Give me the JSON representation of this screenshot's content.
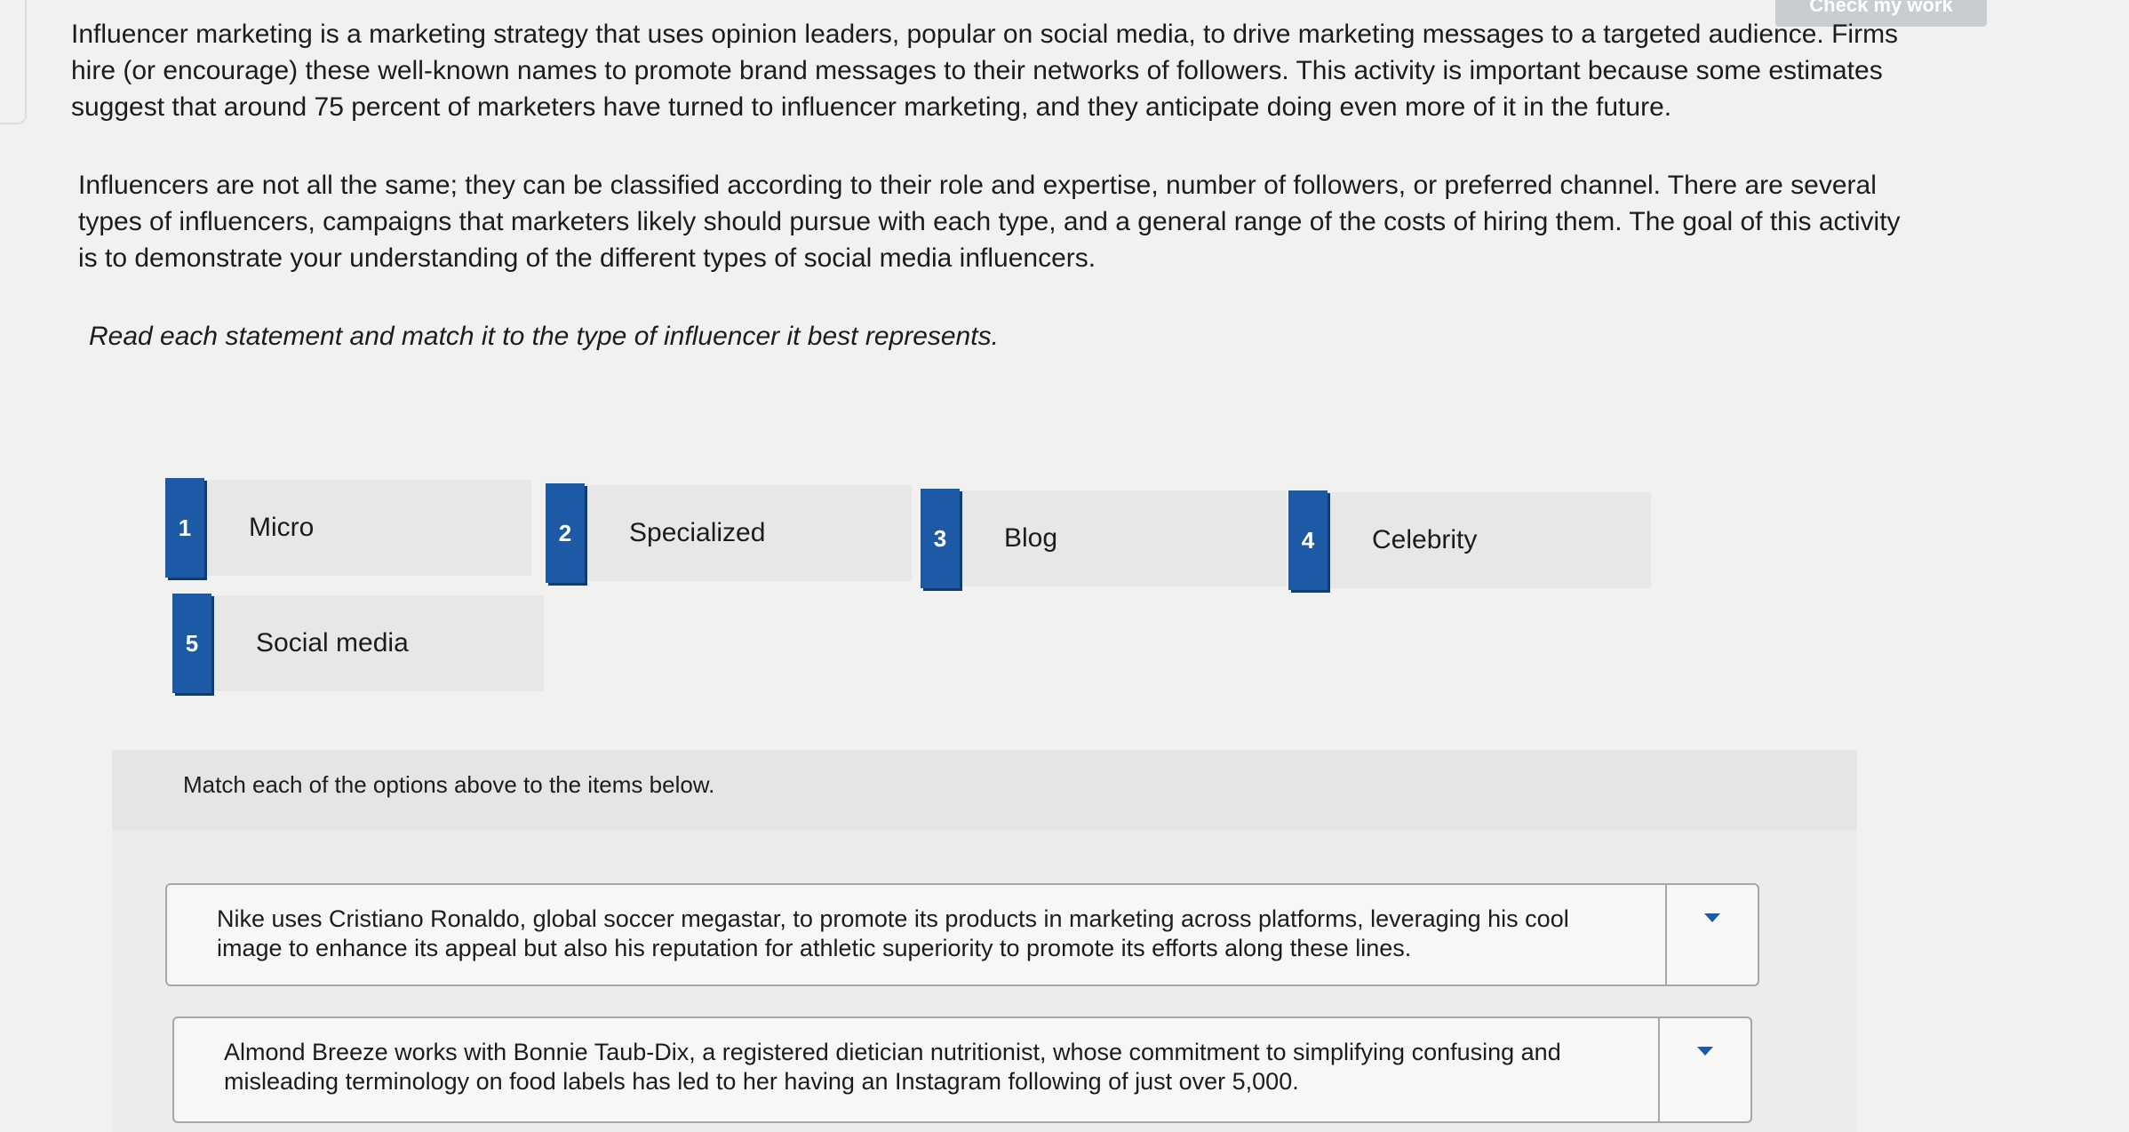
{
  "header": {
    "check_work_label": "Check my work"
  },
  "intro": {
    "paragraph1": "Influencer marketing is a marketing strategy that uses opinion leaders, popular on social media, to drive marketing messages to a targeted audience. Firms hire (or encourage) these well-known names to promote brand messages to their networks of followers. This activity is important because some estimates suggest that around 75 percent of marketers have turned to influencer marketing, and they anticipate doing even more of it in the future.",
    "paragraph2": "Influencers are not all the same; they can be classified according to their role and expertise, number of followers, or preferred channel. There are several types of influencers, campaigns that marketers likely should pursue with each type, and a general range of the costs of hiring them. The goal of this activity is to demonstrate your understanding of the different types of social media influencers.",
    "instruction": "Read each statement and match it to the type of influencer it best represents."
  },
  "options": [
    {
      "number": "1",
      "label": "Micro"
    },
    {
      "number": "2",
      "label": "Specialized"
    },
    {
      "number": "3",
      "label": "Blog"
    },
    {
      "number": "4",
      "label": "Celebrity"
    },
    {
      "number": "5",
      "label": "Social media"
    }
  ],
  "match_prompt": "Match each of the options above to the items below.",
  "items": [
    {
      "text": "Nike uses Cristiano Ronaldo, global soccer megastar, to promote its products in marketing across platforms, leveraging his cool image to enhance its appeal but also his reputation for athletic superiority to promote its efforts along these lines."
    },
    {
      "text": "Almond Breeze works with Bonnie Taub-Dix, a registered dietician nutritionist, whose commitment to simplifying confusing and misleading terminology on food labels has led to her having an Instagram following of just over 5,000."
    }
  ],
  "colors": {
    "accent": "#1c5aa5",
    "chip_bg": "#e7e7e6",
    "page_bg": "#f1f1f0"
  }
}
